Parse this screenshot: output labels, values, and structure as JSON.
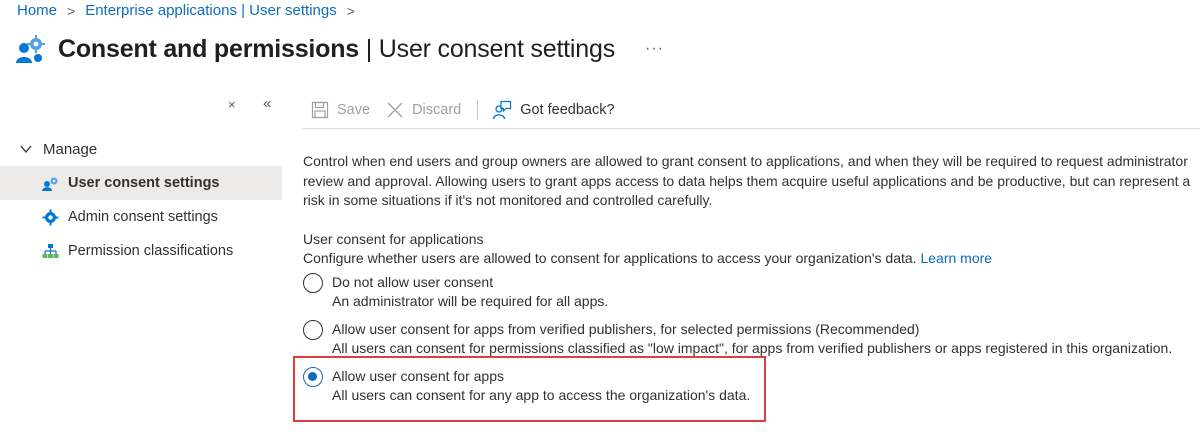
{
  "breadcrumb": {
    "home": "Home",
    "enterprise": "Enterprise applications | User settings"
  },
  "header": {
    "title_bold": "Consent and permissions",
    "title_rest": " | User consent settings",
    "more": "···"
  },
  "sidebar": {
    "collapse_icon": "×",
    "collapse_all": "«",
    "group_label": "Manage",
    "items": [
      {
        "label": "User consent settings"
      },
      {
        "label": "Admin consent settings"
      },
      {
        "label": "Permission classifications"
      }
    ]
  },
  "toolbar": {
    "save_label": "Save",
    "discard_label": "Discard",
    "feedback_label": "Got feedback?"
  },
  "content": {
    "description": "Control when end users and group owners are allowed to grant consent to applications, and when they will be required to request administrator review and approval. Allowing users to grant apps access to data helps them acquire useful applications and be productive, but can represent a risk in some situations if it's not monitored and controlled carefully.",
    "section_label": "User consent for applications",
    "section_desc": "Configure whether users are allowed to consent for applications to access your organization's data.",
    "learn_more": "Learn more",
    "options": [
      {
        "title": "Do not allow user consent",
        "desc": "An administrator will be required for all apps.",
        "selected": false
      },
      {
        "title": "Allow user consent for apps from verified publishers, for selected permissions (Recommended)",
        "desc": "All users can consent for permissions classified as \"low impact\", for apps from verified publishers or apps registered in this organization.",
        "selected": false
      },
      {
        "title": "Allow user consent for apps",
        "desc": "All users can consent for any app to access the organization's data.",
        "selected": true
      }
    ]
  },
  "colors": {
    "link": "#0f6cbd",
    "highlight": "#e03e3e",
    "active_nav": "#edebe9"
  }
}
